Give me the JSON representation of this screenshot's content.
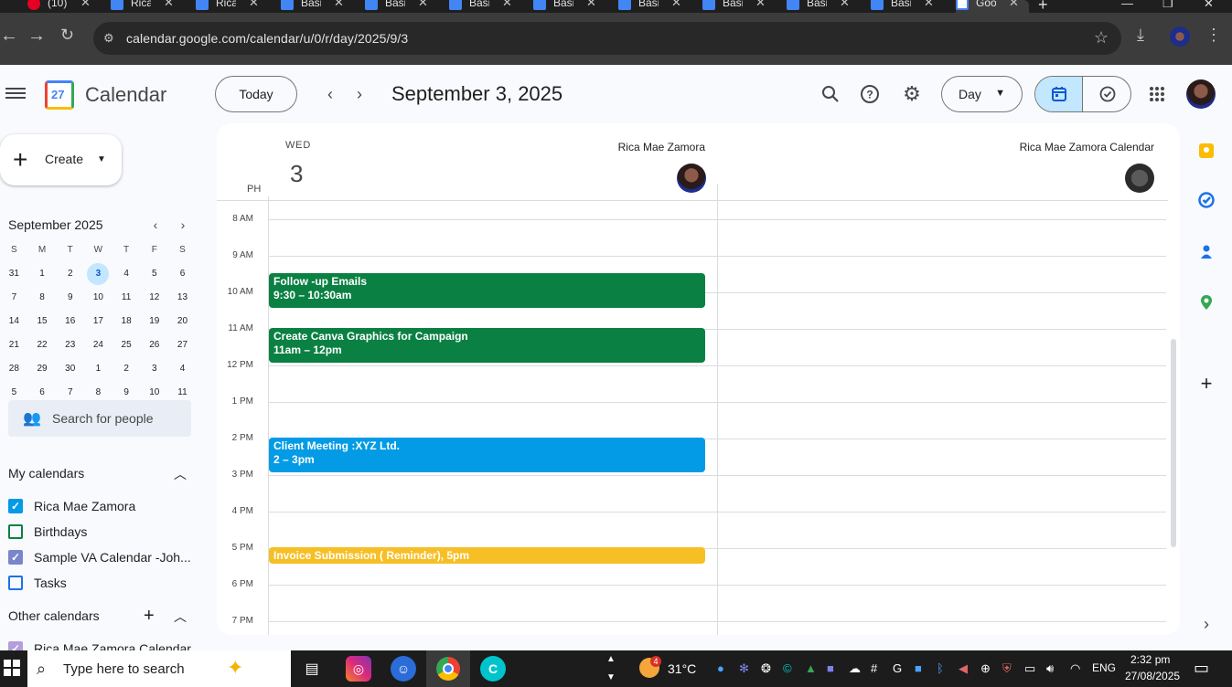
{
  "browser": {
    "tabs": [
      {
        "title": "(10)",
        "icon": "pinterest-icon"
      },
      {
        "title": "Rica",
        "icon": "docs-icon"
      },
      {
        "title": "Rica",
        "icon": "docs-icon"
      },
      {
        "title": "Basi",
        "icon": "docs-icon"
      },
      {
        "title": "Basi",
        "icon": "docs-icon"
      },
      {
        "title": "Basi",
        "icon": "docs-icon"
      },
      {
        "title": "Basi",
        "icon": "docs-icon"
      },
      {
        "title": "Basi",
        "icon": "docs-icon"
      },
      {
        "title": "Basi",
        "icon": "docs-icon"
      },
      {
        "title": "Basi",
        "icon": "docs-icon"
      },
      {
        "title": "Basi",
        "icon": "docs-icon"
      },
      {
        "title": "Goo",
        "icon": "calendar-icon"
      }
    ],
    "url": "calendar.google.com/calendar/u/0/r/day/2025/9/3",
    "new_tab": "+",
    "window_controls": [
      "—",
      "❐",
      "✕"
    ]
  },
  "header": {
    "app_title": "Calendar",
    "logo_day": "27",
    "today": "Today",
    "date_title": "September 3, 2025",
    "view": "Day"
  },
  "sidebar": {
    "create": "Create",
    "mini_cal": {
      "title": "September 2025",
      "weekdays": [
        "S",
        "M",
        "T",
        "W",
        "T",
        "F",
        "S"
      ],
      "weeks": [
        [
          "31",
          "1",
          "2",
          "3",
          "4",
          "5",
          "6"
        ],
        [
          "7",
          "8",
          "9",
          "10",
          "11",
          "12",
          "13"
        ],
        [
          "14",
          "15",
          "16",
          "17",
          "18",
          "19",
          "20"
        ],
        [
          "21",
          "22",
          "23",
          "24",
          "25",
          "26",
          "27"
        ],
        [
          "28",
          "29",
          "30",
          "1",
          "2",
          "3",
          "4"
        ],
        [
          "5",
          "6",
          "7",
          "8",
          "9",
          "10",
          "11"
        ]
      ],
      "selected": "3"
    },
    "search_people": "Search for people",
    "my_calendars_title": "My calendars",
    "my_calendars": [
      {
        "name": "Rica Mae Zamora",
        "color": "#039be5",
        "checked": true
      },
      {
        "name": "Birthdays",
        "color": "#0b8043",
        "checked": false
      },
      {
        "name": "Sample VA Calendar -Joh...",
        "color": "#7986cb",
        "checked": true
      },
      {
        "name": "Tasks",
        "color": "#1a73e8",
        "checked": false
      }
    ],
    "other_calendars_title": "Other calendars",
    "other_calendars": [
      {
        "name": "Rica Mae Zamora Calendar",
        "color": "#b39ddb",
        "checked": true
      }
    ]
  },
  "day_view": {
    "weekday": "WED",
    "day_number": "3",
    "timezone": "PH",
    "columns": [
      "Rica Mae Zamora",
      "Rica Mae Zamora Calendar"
    ],
    "hours": [
      "8 AM",
      "9 AM",
      "10 AM",
      "11 AM",
      "12 PM",
      "1 PM",
      "2 PM",
      "3 PM",
      "4 PM",
      "5 PM",
      "6 PM",
      "7 PM"
    ],
    "events": [
      {
        "title": "Follow -up Emails",
        "time": "9:30 – 10:30am",
        "color": "#0b8043"
      },
      {
        "title": "Create Canva Graphics for Campaign",
        "time": "11am – 12pm",
        "color": "#0b8043"
      },
      {
        "title": "Client Meeting :XYZ Ltd.",
        "time": "2 – 3pm",
        "color": "#039be5"
      },
      {
        "title": "Invoice Submission ( Reminder), 5pm",
        "time": "",
        "color": "#f6bf26"
      }
    ]
  },
  "taskbar": {
    "search_placeholder": "Type here to search",
    "weather": "31°C",
    "language": "ENG",
    "time": "2:32 pm",
    "date": "27/08/2025",
    "weather_badge": "4"
  }
}
